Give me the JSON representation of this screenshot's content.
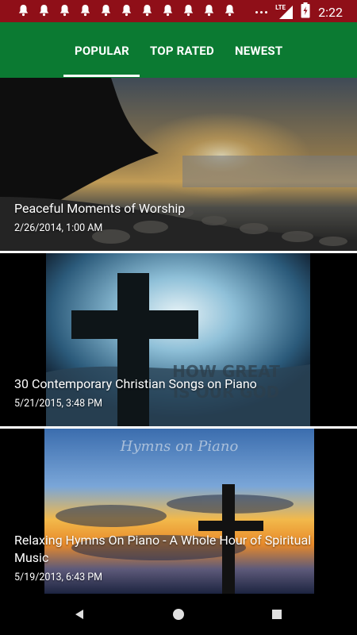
{
  "status_bar": {
    "time": "2:22",
    "network": "LTE",
    "notification_icons": [
      "bell-icon",
      "bell-icon",
      "bell-icon",
      "bell-icon",
      "bell-icon",
      "bell-icon",
      "bell-icon",
      "bell-icon",
      "bell-icon",
      "bell-icon",
      "bell-icon"
    ]
  },
  "tabs": [
    {
      "label": "POPULAR",
      "selected": true
    },
    {
      "label": "TOP RATED",
      "selected": false
    },
    {
      "label": "NEWEST",
      "selected": false
    }
  ],
  "videos": [
    {
      "title": "Peaceful Moments of Worship",
      "date": "2/26/2014, 1:00 AM",
      "thumb": "sunset-shore"
    },
    {
      "title": "30 Contemporary Christian Songs on Piano",
      "date": "5/21/2015, 3:48 PM",
      "thumb": "cross-sky",
      "overlay_text": "HOW GREAT IS OUR GOD"
    },
    {
      "title": "Relaxing Hymns On Piano - A Whole Hour of Spiritual Music",
      "date": "5/19/2013, 6:43 PM",
      "thumb": "cross-sunset",
      "overlay_text": "Hymns on Piano"
    }
  ],
  "colors": {
    "status_bar": "#8f0f18",
    "toolbar": "#0b7a32",
    "nav_bar": "#000000"
  }
}
